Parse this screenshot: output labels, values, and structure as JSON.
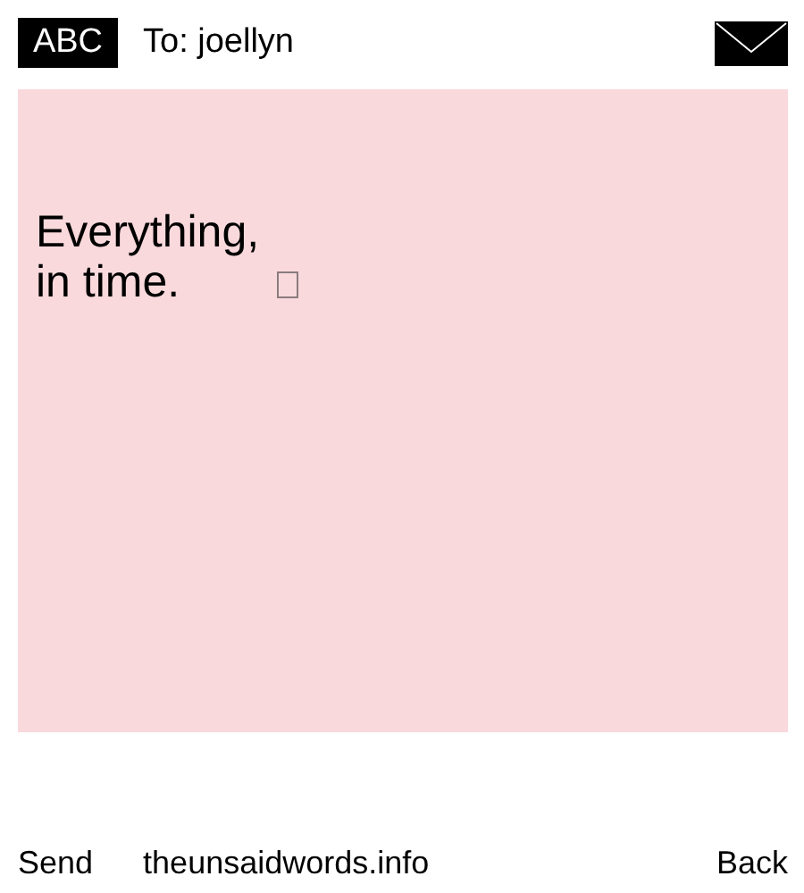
{
  "header": {
    "mode": "ABC",
    "recipient": "To: joellyn"
  },
  "message": {
    "text": "Everything,\nin time."
  },
  "footer": {
    "left": "Send",
    "center": "theunsaidwords.info",
    "right": "Back"
  }
}
